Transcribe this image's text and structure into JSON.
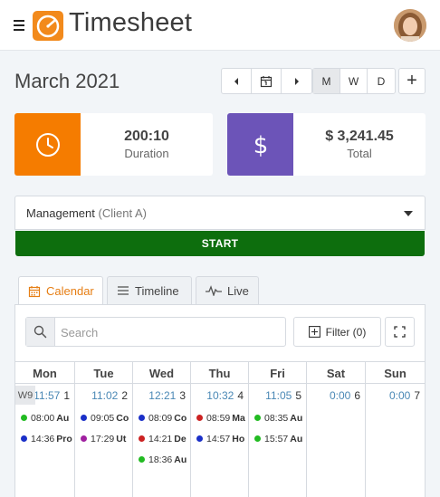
{
  "app": {
    "title": "Timesheet"
  },
  "period": {
    "title": "March 2021"
  },
  "views": {
    "month": "M",
    "week": "W",
    "day": "D",
    "add": "+"
  },
  "stats": {
    "duration": {
      "value": "200:10",
      "label": "Duration",
      "color": "#f57c00"
    },
    "total": {
      "value": "$ 3,241.45",
      "label": "Total",
      "color": "#6c54b8"
    }
  },
  "project": {
    "name": "Management",
    "client": "(Client A)"
  },
  "start_button": "START",
  "tabs": [
    {
      "label": "Calendar",
      "icon": "calendar-icon",
      "active": true
    },
    {
      "label": "Timeline",
      "icon": "list-icon",
      "active": false
    },
    {
      "label": "Live",
      "icon": "pulse-icon",
      "active": false
    }
  ],
  "search": {
    "placeholder": "Search"
  },
  "filter": {
    "label": "Filter (0)"
  },
  "calendar": {
    "week_label": "W9",
    "days": [
      {
        "name": "Mon",
        "total": "11:57",
        "date": "1",
        "entries": [
          {
            "time": "08:00",
            "title": "Au",
            "color": "#22bb22"
          },
          {
            "time": "14:36",
            "title": "Pro",
            "color": "#1a2fc8"
          }
        ]
      },
      {
        "name": "Tue",
        "total": "11:02",
        "date": "2",
        "entries": [
          {
            "time": "09:05",
            "title": "Co",
            "color": "#1a2fc8"
          },
          {
            "time": "17:29",
            "title": "Ut",
            "color": "#a020a0"
          }
        ]
      },
      {
        "name": "Wed",
        "total": "12:21",
        "date": "3",
        "entries": [
          {
            "time": "08:09",
            "title": "Co",
            "color": "#1a2fc8"
          },
          {
            "time": "14:21",
            "title": "De",
            "color": "#cc2222"
          },
          {
            "time": "18:36",
            "title": "Au",
            "color": "#22bb22"
          }
        ]
      },
      {
        "name": "Thu",
        "total": "10:32",
        "date": "4",
        "entries": [
          {
            "time": "08:59",
            "title": "Ma",
            "color": "#cc2222"
          },
          {
            "time": "14:57",
            "title": "Ho",
            "color": "#1a2fc8"
          }
        ]
      },
      {
        "name": "Fri",
        "total": "11:05",
        "date": "5",
        "entries": [
          {
            "time": "08:35",
            "title": "Au",
            "color": "#22bb22"
          },
          {
            "time": "15:57",
            "title": "Au",
            "color": "#22bb22"
          }
        ]
      },
      {
        "name": "Sat",
        "total": "0:00",
        "date": "6",
        "entries": []
      },
      {
        "name": "Sun",
        "total": "0:00",
        "date": "7",
        "entries": []
      }
    ]
  }
}
